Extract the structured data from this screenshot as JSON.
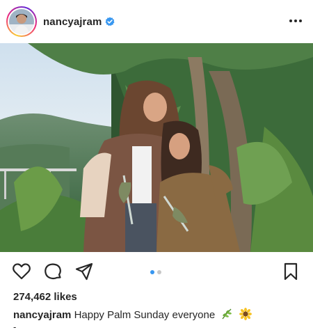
{
  "post": {
    "username": "nancyajram",
    "verified": true,
    "likes": "274,462 likes",
    "caption_user": "nancyajram",
    "caption_text": "Happy Palm Sunday everyone",
    "caption_emojis": [
      "herb-emoji",
      "sunflower-emoji"
    ],
    "more_marker": "-",
    "carousel": {
      "count": 2,
      "active_index": 0
    }
  },
  "icons": {
    "header": [
      "verified-badge-icon",
      "more-options-icon"
    ],
    "actions": [
      "heart-icon",
      "comment-icon",
      "share-icon",
      "bookmark-icon"
    ]
  },
  "colors": {
    "verified_blue": "#3897f0",
    "active_dot": "#3897f0",
    "inactive_dot": "#c7c7c7",
    "text": "#262626"
  }
}
